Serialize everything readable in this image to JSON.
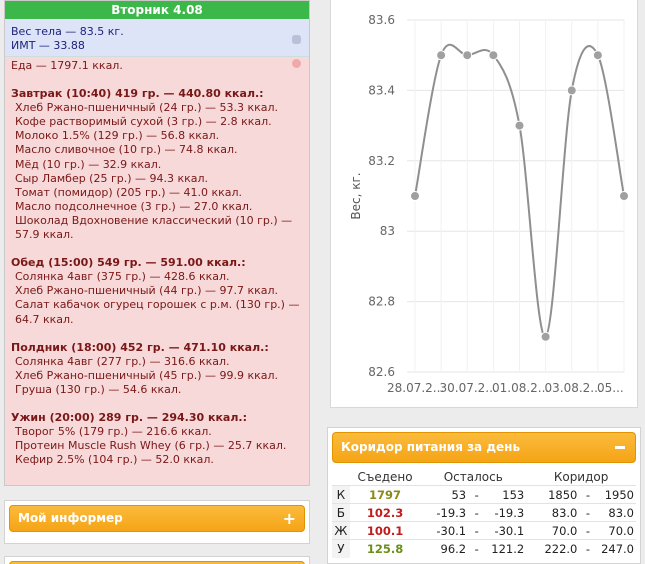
{
  "diary": {
    "day_title": "Вторник 4.08",
    "body_weight": "Вес тела — 83.5 кг.",
    "bmi": "ИМТ — 33.88",
    "food_total": "Еда — 1797.1 ккал.",
    "meals": [
      {
        "title": "Завтрак (10:40) 419 гр. — 440.80 ккал.:",
        "items": [
          "Хлеб Ржано-пшеничный (24 гр.) — 53.3 ккал.",
          "Кофе растворимый сухой (3 гр.) — 2.8 ккал.",
          "Молоко 1.5% (129 гр.) — 56.8 ккал.",
          "Масло сливочное (10 гр.) — 74.8 ккал.",
          "Мёд (10 гр.) — 32.9 ккал.",
          "Сыр Ламбер (25 гр.) — 94.3 ккал.",
          "Томат (помидор) (205 гр.) — 41.0 ккал.",
          "Масло подсолнечное (3 гр.) — 27.0 ккал.",
          "Шоколад Вдохновение классический (10 гр.) —",
          "57.9 ккал."
        ]
      },
      {
        "title": "Обед (15:00) 549 гр. — 591.00 ккал.:",
        "items": [
          "Солянка 4авг (375 гр.) — 428.6 ккал.",
          "Хлеб Ржано-пшеничный (44 гр.) — 97.7 ккал.",
          "Салат кабачок огурец горошек с р.м. (130 гр.) —",
          "64.7 ккал."
        ]
      },
      {
        "title": "Полдник (18:00) 452 гр. — 471.10 ккал.:",
        "items": [
          "Солянка 4авг (277 гр.) — 316.6 ккал.",
          "Хлеб Ржано-пшеничный (45 гр.) — 99.9 ккал.",
          "Груша (130 гр.) — 54.6 ккал."
        ]
      },
      {
        "title": "Ужин (20:00) 289 гр. — 294.30 ккал.:",
        "items": [
          "Творог 5% (179 гр.) — 216.6 ккал.",
          "Протеин Muscle Rush Whey (6 гр.) — 25.7 ккал.",
          "Кефир 2.5% (104 гр.) — 52.0 ккал."
        ]
      }
    ]
  },
  "widgets": {
    "informer_label": "Мой информер",
    "informer_icon": "plus-icon",
    "corridor_label": "Коридор питания за день",
    "corridor_icon": "minus-icon"
  },
  "corridor_table": {
    "headers": [
      "Съедено",
      "Осталось",
      "Коридор"
    ],
    "rows": [
      {
        "label": "К",
        "eaten": "1797",
        "left_a": "53",
        "left_b": "153",
        "cor_a": "1850",
        "cor_b": "1950"
      },
      {
        "label": "Б",
        "eaten": "102.3",
        "left_a": "-19.3",
        "left_b": "-19.3",
        "cor_a": "83.0",
        "cor_b": "83.0"
      },
      {
        "label": "Ж",
        "eaten": "100.1",
        "left_a": "-30.1",
        "left_b": "-30.1",
        "cor_a": "70.0",
        "cor_b": "70.0"
      },
      {
        "label": "У",
        "eaten": "125.8",
        "left_a": "96.2",
        "left_b": "121.2",
        "cor_a": "222.0",
        "cor_b": "247.0"
      }
    ],
    "dash": "-"
  },
  "colors": {
    "header_green": "#3cb84b",
    "widget_orange": "#f5a416",
    "line": "#8f8f8f",
    "eaten_k": "#8a8a19",
    "eaten_b": "#c01d1d",
    "eaten_zh": "#c01d1d",
    "eaten_u": "#6c8f1a"
  },
  "chart_data": {
    "type": "line",
    "ylabel": "Вес, кг.",
    "ylim": [
      82.6,
      83.6
    ],
    "yticks": [
      "83.6",
      "83.4",
      "83.2",
      "83",
      "82.8",
      "82.6"
    ],
    "xtick_labels": [
      "28.07.2...",
      "30.07.2...",
      "01.08.2...",
      "03.08.2...",
      "05..."
    ],
    "x": [
      "28.07",
      "29.07",
      "30.07",
      "31.07",
      "01.08",
      "02.08",
      "03.08",
      "04.08",
      "05.08"
    ],
    "values": [
      83.1,
      83.5,
      83.5,
      83.5,
      83.3,
      82.7,
      83.4,
      83.5,
      83.1
    ],
    "grid": true
  }
}
